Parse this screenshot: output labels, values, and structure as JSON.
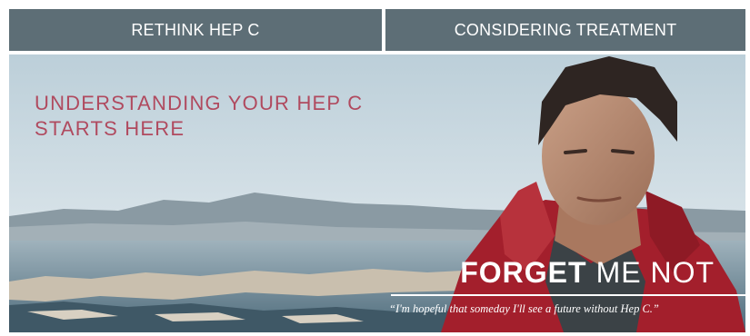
{
  "nav": {
    "tabs": [
      {
        "label": "RETHINK HEP C"
      },
      {
        "label": "CONSIDERING TREATMENT"
      }
    ]
  },
  "banner": {
    "headline_line1": "UNDERSTANDING YOUR HEP C",
    "headline_line2": "STARTS HERE",
    "brand_bold": "FORGET",
    "brand_light": "ME NOT",
    "quote": "“I'm hopeful that someday I'll see a future without Hep C.”"
  },
  "colors": {
    "nav_background": "#5d6e76",
    "headline": "#b04a5f",
    "jacket": "#a31f2c",
    "sky": "#c7d6de",
    "water": "#5f7f90"
  }
}
